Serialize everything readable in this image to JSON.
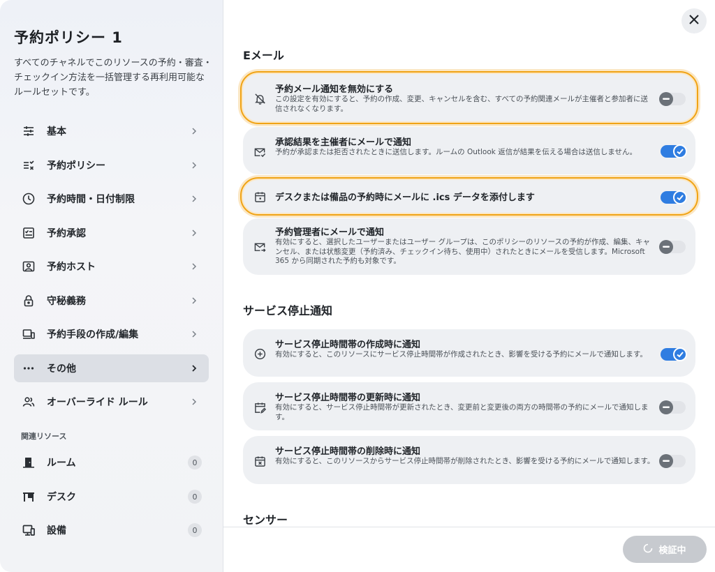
{
  "sidebar": {
    "title": "予約ポリシー 1",
    "description": "すべてのチャネルでこのリソースの予約・審査・チェックイン方法を一括管理する再利用可能なルールセットです。",
    "items": [
      {
        "label": "基本",
        "icon": "sliders-icon"
      },
      {
        "label": "予約ポリシー",
        "icon": "list-check-icon"
      },
      {
        "label": "予約時間・日付制限",
        "icon": "clock-icon"
      },
      {
        "label": "予約承認",
        "icon": "approval-icon"
      },
      {
        "label": "予約ホスト",
        "icon": "host-icon"
      },
      {
        "label": "守秘義務",
        "icon": "lock-icon"
      },
      {
        "label": "予約手段の作成/編集",
        "icon": "devices-icon"
      },
      {
        "label": "その他",
        "icon": "more-icon",
        "active": true
      },
      {
        "label": "オーバーライド ルール",
        "icon": "people-icon"
      }
    ],
    "related_heading": "関連リソース",
    "resources": [
      {
        "label": "ルーム",
        "count": "0",
        "icon": "room-icon"
      },
      {
        "label": "デスク",
        "count": "0",
        "icon": "desk-icon"
      },
      {
        "label": "設備",
        "count": "0",
        "icon": "equipment-icon"
      }
    ]
  },
  "main": {
    "email_heading": "Eメール",
    "email_items": [
      {
        "title": "予約メール通知を無効にする",
        "desc": "この設定を有効にすると、予約の作成、変更、キャンセルを含む、すべての予約関連メールが主催者と参加者に送信されなくなります。",
        "enabled": false,
        "highlighted": true,
        "icon": "bell-off-icon"
      },
      {
        "title": "承認結果を主催者にメールで通知",
        "desc": "予約が承認または拒否されたときに送信します。ルームの Outlook 返信が結果を伝える場合は送信しません。",
        "enabled": true,
        "highlighted": false,
        "icon": "mail-check-icon"
      },
      {
        "title": "デスクまたは備品の予約時にメールに .ics データを添付します",
        "desc": "",
        "enabled": true,
        "highlighted": true,
        "icon": "calendar-icon"
      },
      {
        "title": "予約管理者にメールで通知",
        "desc": "有効にすると、選択したユーザーまたはユーザー グループは、このポリシーのリソースの予約が作成、編集、キャンセル、または状態変更（予約済み、チェックイン待ち、使用中）されたときにメールを受信します。Microsoft 365 から同期された予約も対象です。",
        "enabled": false,
        "highlighted": false,
        "icon": "mail-forward-icon"
      }
    ],
    "outage_heading": "サービス停止通知",
    "outage_items": [
      {
        "title": "サービス停止時間帯の作成時に通知",
        "desc": "有効にすると、このリソースにサービス停止時間帯が作成されたとき、影響を受ける予約にメールで通知します。",
        "enabled": true,
        "icon": "plus-circle-icon"
      },
      {
        "title": "サービス停止時間帯の更新時に通知",
        "desc": "有効にすると、サービス停止時間帯が更新されたとき、変更前と変更後の両方の時間帯の予約にメールで通知します。",
        "enabled": false,
        "icon": "calendar-edit-icon"
      },
      {
        "title": "サービス停止時間帯の削除時に通知",
        "desc": "有効にすると、このリソースからサービス停止時間帯が削除されたとき、影響を受ける予約にメールで通知します。",
        "enabled": false,
        "icon": "calendar-x-icon"
      }
    ],
    "sensor_heading": "センサー"
  },
  "footer": {
    "verify_label": "検証中"
  },
  "colors": {
    "accent": "#2f7de1",
    "highlight": "#f0a315"
  }
}
